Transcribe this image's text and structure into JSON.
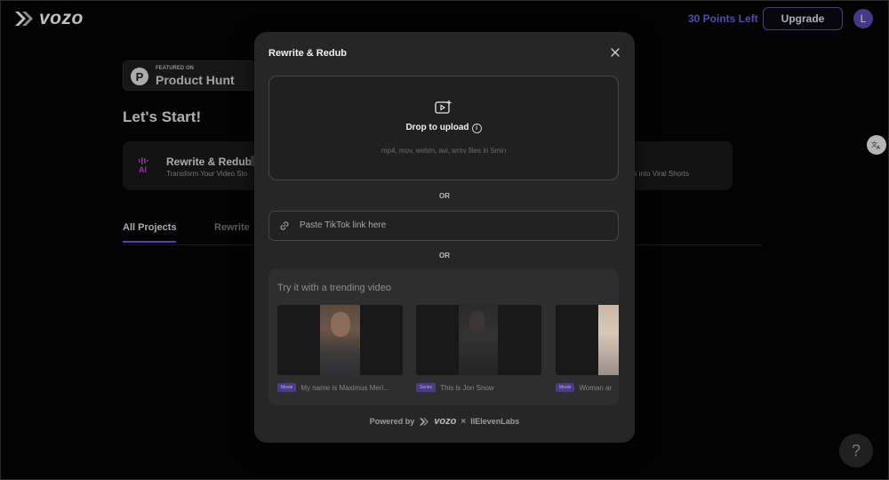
{
  "header": {
    "brand": "vozo",
    "points": "30 Points Left",
    "upgrade_label": "Upgrade",
    "avatar_initial": "L"
  },
  "background": {
    "product_hunt": {
      "featured": "FEATURED ON",
      "title": "Product Hunt"
    },
    "heading": "Let's Start!",
    "feature_card": {
      "icon_text": "AI",
      "title": "Rewrite & Redub",
      "subtitle": "Transform Your Video Sto",
      "right_text": "os into Viral Shorts"
    },
    "tabs": [
      {
        "label": "All Projects",
        "active": true
      },
      {
        "label": "Rewrite",
        "active": false
      }
    ]
  },
  "modal": {
    "title": "Rewrite & Redub",
    "dropzone": {
      "label": "Drop to upload",
      "formats": "mp4, mov, webm, avi, wmv files in 5min"
    },
    "or_text": "OR",
    "link_placeholder": "Paste TikTok link here",
    "trending": {
      "title": "Try it with a trending video",
      "items": [
        {
          "tag": "Movie",
          "caption": "My name is Maximus Meri..."
        },
        {
          "tag": "Series",
          "caption": "This is Jon Snow"
        },
        {
          "tag": "Movie",
          "caption": "Woman ar"
        }
      ]
    },
    "powered": {
      "prefix": "Powered by",
      "brand": "vozo",
      "separator": "×",
      "partner": "IIElevenLabs"
    }
  },
  "help_label": "?",
  "colors": {
    "accent": "#6f63e8",
    "tag_bg": "#4a3c85",
    "modal_bg": "#262626"
  }
}
